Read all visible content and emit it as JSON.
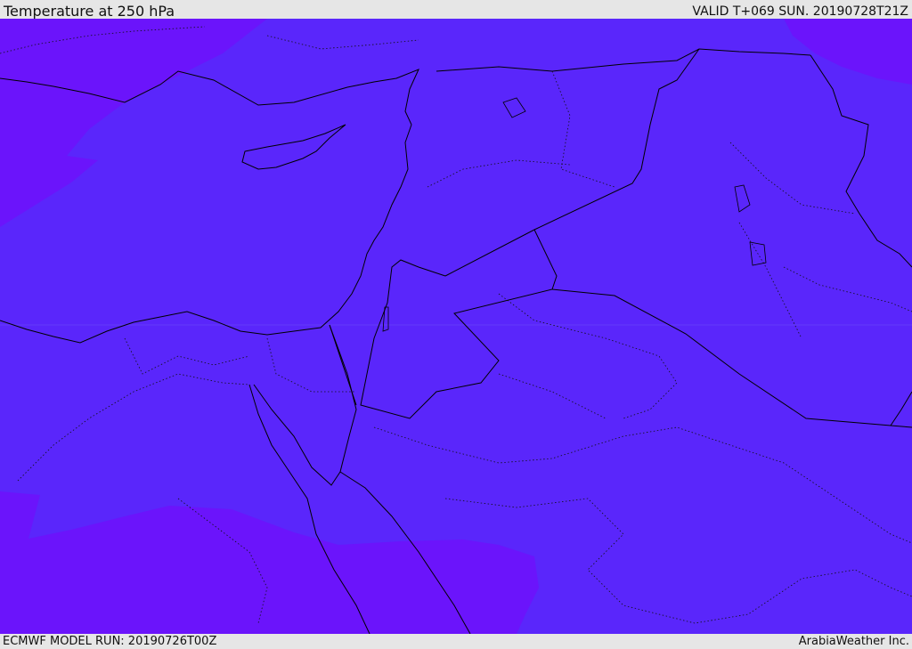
{
  "header": {
    "title": "Temperature at 250 hPa",
    "valid": "VALID T+069 SUN. 20190728T21Z"
  },
  "footer": {
    "model_run": "ECMWF MODEL RUN: 20190726T00Z",
    "credit": "ArabiaWeather Inc."
  },
  "colors": {
    "warm_band": "#5a26fb",
    "cool_band": "#6b14fb",
    "coastline": "#000000",
    "background": "#e6e6e6"
  }
}
